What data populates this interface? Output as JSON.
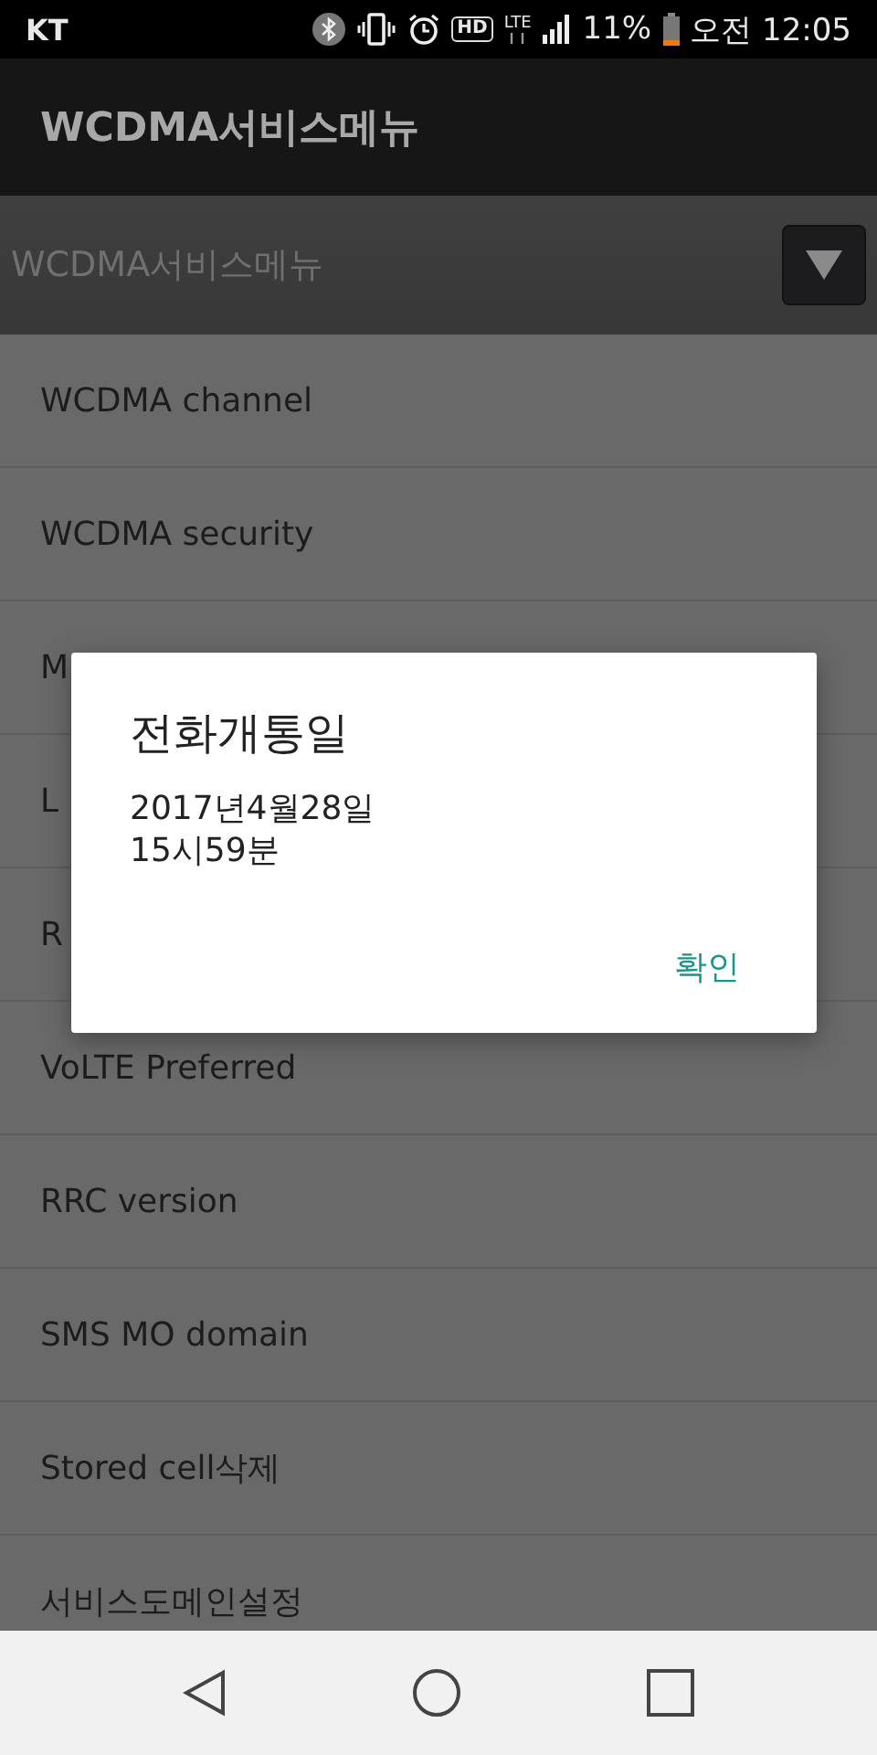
{
  "status_bar": {
    "carrier": "KT",
    "hd_label": "HD",
    "network_label": "LTE",
    "battery": "11%",
    "time": "오전 12:05"
  },
  "app_bar": {
    "title": "WCDMA서비스메뉴"
  },
  "spinner": {
    "value": "WCDMA서비스메뉴"
  },
  "menu_items": [
    {
      "label": "WCDMA channel"
    },
    {
      "label": "WCDMA security"
    },
    {
      "label": "M"
    },
    {
      "label": "L"
    },
    {
      "label": "R"
    },
    {
      "label": "VoLTE Preferred"
    },
    {
      "label": "RRC version"
    },
    {
      "label": "SMS MO domain"
    },
    {
      "label": "Stored cell삭제"
    },
    {
      "label": "서비스도메인설정"
    }
  ],
  "dialog": {
    "title": "전화개통일",
    "lines": [
      "2017년4월28일",
      "15시59분"
    ],
    "button": "확인"
  },
  "nav_bar": {
    "buttons": [
      {
        "kind": "back"
      },
      {
        "kind": "home"
      },
      {
        "kind": "recents"
      }
    ]
  }
}
